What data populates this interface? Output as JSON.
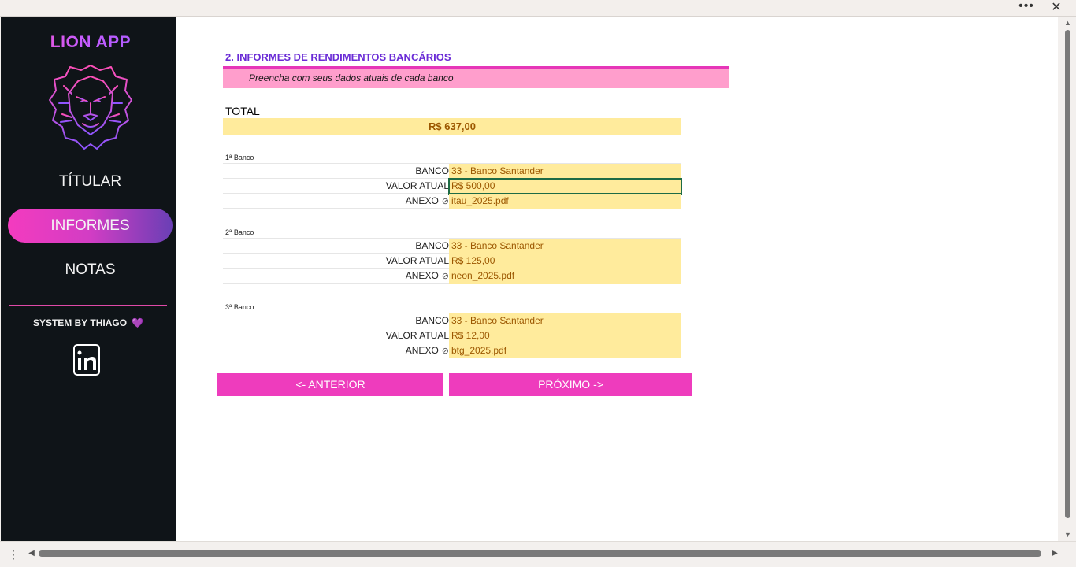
{
  "window": {
    "more_icon": "more-horizontal-icon",
    "close_icon": "close-icon"
  },
  "sidebar": {
    "brand": "LION APP",
    "nav": [
      {
        "label": "TÍTULAR",
        "active": false
      },
      {
        "label": "INFORMES",
        "active": true
      },
      {
        "label": "NOTAS",
        "active": false
      }
    ],
    "system_by": "SYSTEM BY THIAGO",
    "heart": "💜"
  },
  "main": {
    "section_title": "2. INFORMES DE RENDIMENTOS BANCÁRIOS",
    "subtitle": "Preencha com seus dados atuais de cada banco",
    "total_label": "TOTAL",
    "total_value": "R$ 637,00",
    "banks": [
      {
        "label": "1ª Banco",
        "banco_label": "BANCO",
        "banco": "33 - Banco Santander",
        "valor_label": "VALOR ATUAL",
        "valor": "R$ 500,00",
        "anexo_label": "ANEXO",
        "anexo": "itau_2025.pdf"
      },
      {
        "label": "2ª Banco",
        "banco_label": "BANCO",
        "banco": "33 - Banco Santander",
        "valor_label": "VALOR ATUAL",
        "valor": "R$ 125,00",
        "anexo_label": "ANEXO",
        "anexo": "neon_2025.pdf"
      },
      {
        "label": "3ª Banco",
        "banco_label": "BANCO",
        "banco": "33 - Banco Santander",
        "valor_label": "VALOR ATUAL",
        "valor": "R$ 12,00",
        "anexo_label": "ANEXO",
        "anexo": "btg_2025.pdf"
      }
    ],
    "prev_button": "<- ANTERIOR",
    "next_button": "PRÓXIMO ->"
  },
  "colors": {
    "accent": "#ee3cbd",
    "title": "#6a2bd6",
    "input_bg": "#ffeb9c",
    "input_text": "#9c5700",
    "sidebar_bg": "#0f1418"
  }
}
